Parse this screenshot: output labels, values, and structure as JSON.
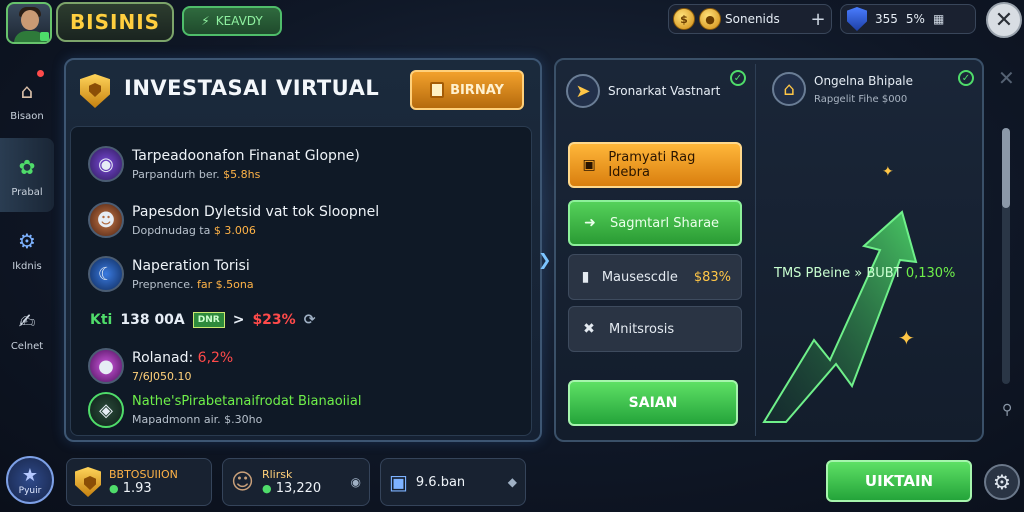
{
  "header": {
    "title": "BISINIS",
    "ready_label": "KEAVDY",
    "resource_left_label": "Sonenids",
    "resource_right_a": "355",
    "resource_right_b": "5%"
  },
  "sidebar": {
    "items": [
      {
        "label": "Bisaon",
        "icon": "home-icon"
      },
      {
        "label": "Prabal",
        "icon": "leaf-icon"
      },
      {
        "label": "Ikdnis",
        "icon": "chart-icon"
      },
      {
        "label": "Celnet",
        "icon": "chat-icon"
      }
    ]
  },
  "main_panel": {
    "title": "INVESTASAI VIRTUAL",
    "action_button": "BIRNAY",
    "items": [
      {
        "title": "Tarpeadoonafon Finanat Glopne)",
        "sub_label": "Parpandurh ber.",
        "sub_value": "$5.8hs",
        "icon": "purple-avatar-icon"
      },
      {
        "title": "Papesdon Dyletsid vat tok Sloopnel",
        "sub_label": "Dopdnudag ta",
        "sub_value": "$ 3.006",
        "icon": "character-avatar-icon"
      },
      {
        "title": "Naperation Torisi",
        "sub_label": "Prepnence.",
        "sub_value": "far $.5ona",
        "icon": "globe-icon"
      }
    ],
    "stat_row": {
      "prefix": "Kti",
      "value": "138 00A",
      "badge": "DNR",
      "arrow": ">",
      "percent": "$23%"
    },
    "item_four": {
      "title": "Rolanad:",
      "percent": "6,2%",
      "sub": "7/6J050.10"
    },
    "item_five": {
      "title": "Nathe'sPirabetanaifrodat Bianaoiial",
      "sub": "Mapadmonn air. $.30ho"
    }
  },
  "right_panel": {
    "left_head": "Sronarkat Vastnart",
    "right_head_title": "Ongelna Bhipale",
    "right_head_sub": "Rapgelit Fihe $000",
    "menu": [
      {
        "label": "Pramyati Rag Idebra",
        "style": "orange",
        "icon": "tag-icon"
      },
      {
        "label": "Sagmtarl Sharae",
        "style": "green",
        "icon": "share-icon"
      },
      {
        "label": "Mausescdle",
        "value": "$83%",
        "style": "gray",
        "icon": "bottle-icon"
      },
      {
        "label": "Mnitsrosis",
        "style": "gray",
        "icon": "tools-icon"
      }
    ],
    "save_button": "SAIAN",
    "chart_label": "TMS PBeine » BUBT",
    "chart_percent": "0,130%"
  },
  "bottom_bar": {
    "avatar_label": "Pyuir",
    "card1": {
      "title": "BBTOSUIION",
      "value": "1.93"
    },
    "card2": {
      "title": "Rlirsk",
      "value": "13,220"
    },
    "card3": {
      "value": "9.6.ban"
    },
    "obtain_button": "UIKTAIN"
  },
  "colors": {
    "accent_green": "#4fdc6a",
    "accent_gold": "#ffc646",
    "accent_orange": "#f2a12c"
  }
}
